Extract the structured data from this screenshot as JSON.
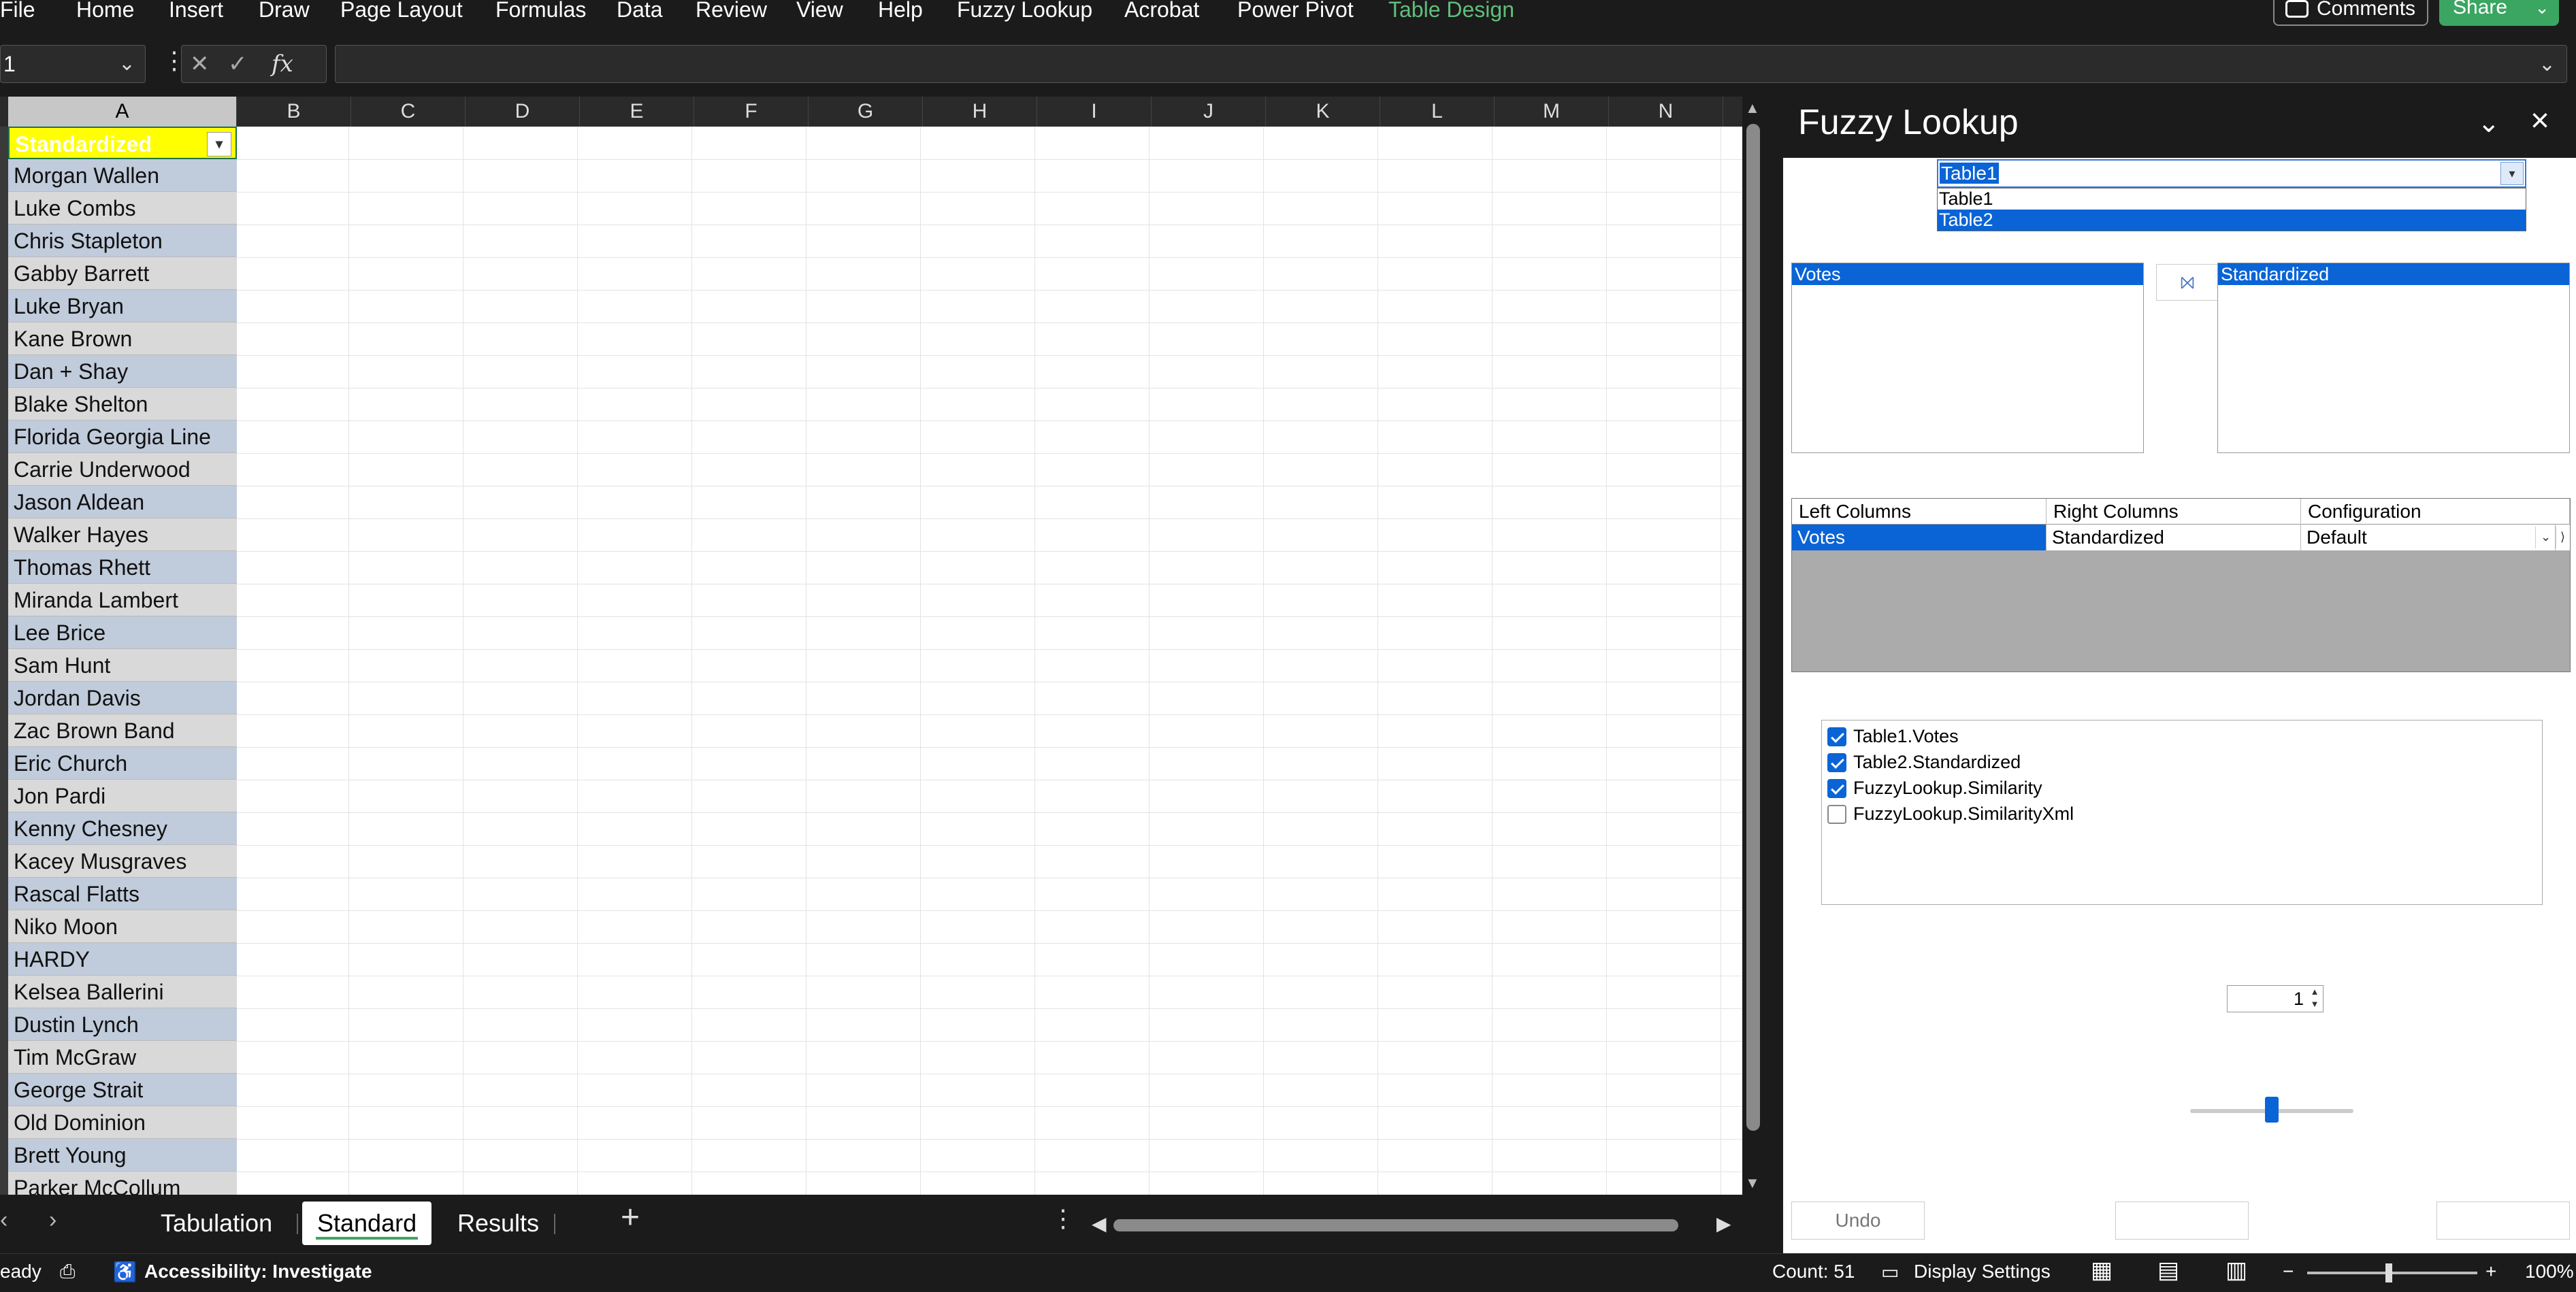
{
  "ribbon": {
    "menu": [
      "File",
      "Home",
      "Insert",
      "Draw",
      "Page Layout",
      "Formulas",
      "Data",
      "Review",
      "View",
      "Help",
      "Fuzzy Lookup",
      "Acrobat",
      "Power Pivot",
      "Table Design"
    ],
    "comments_label": "Comments",
    "share_label": "Share"
  },
  "formula_bar": {
    "name_box": "1",
    "fx_label": "fx",
    "formula": ""
  },
  "grid": {
    "columns": [
      "A",
      "B",
      "C",
      "D",
      "E",
      "F",
      "G",
      "H",
      "I",
      "J",
      "K",
      "L",
      "M",
      "N"
    ],
    "column_a": {
      "header": "Standardized",
      "values": [
        "Morgan Wallen",
        "Luke Combs",
        "Chris Stapleton",
        "Gabby Barrett",
        "Luke Bryan",
        "Kane Brown",
        "Dan + Shay",
        "Blake Shelton",
        "Florida Georgia Line",
        "Carrie Underwood",
        "Jason Aldean",
        "Walker Hayes",
        "Thomas Rhett",
        "Miranda Lambert",
        "Lee Brice",
        "Sam Hunt",
        "Jordan Davis",
        "Zac Brown Band",
        "Eric Church",
        "Jon Pardi",
        "Kenny Chesney",
        "Kacey Musgraves",
        "Rascal Flatts",
        "Niko Moon",
        "HARDY",
        "Kelsea Ballerini",
        "Dustin Lynch",
        "Tim McGraw",
        "George Strait",
        "Old Dominion",
        "Brett Young",
        "Parker McCollum"
      ]
    }
  },
  "sheet_tabs": {
    "tabs": [
      "Tabulation",
      "Standard",
      "Results"
    ],
    "active": "Standard",
    "add_label": "+"
  },
  "status_bar": {
    "ready": "eady",
    "accessibility": "Accessibility: Investigate",
    "count": "Count: 51",
    "display_settings": "Display Settings",
    "zoom": "100%",
    "zoom_minus": "−",
    "zoom_plus": "+"
  },
  "fuzzy_lookup": {
    "title": "Fuzzy Lookup",
    "table_select": {
      "value": "Table1",
      "options": [
        "Table1",
        "Table2"
      ],
      "highlighted": "Table2"
    },
    "left_columns_list": [
      "Votes"
    ],
    "right_columns_list": [
      "Standardized"
    ],
    "join_button_icon": "⨝",
    "mapping": {
      "headers": [
        "Left Columns",
        "Right Columns",
        "Configuration"
      ],
      "rows": [
        {
          "left": "Votes",
          "right": "Standardized",
          "config": "Default"
        }
      ]
    },
    "output_columns": [
      {
        "label": "Table1.Votes",
        "checked": true
      },
      {
        "label": "Table2.Standardized",
        "checked": true
      },
      {
        "label": "FuzzyLookup.Similarity",
        "checked": true
      },
      {
        "label": "FuzzyLookup.SimilarityXml",
        "checked": false
      }
    ],
    "match_count": "1",
    "similarity_threshold": 0.5,
    "undo_label": "Undo"
  }
}
